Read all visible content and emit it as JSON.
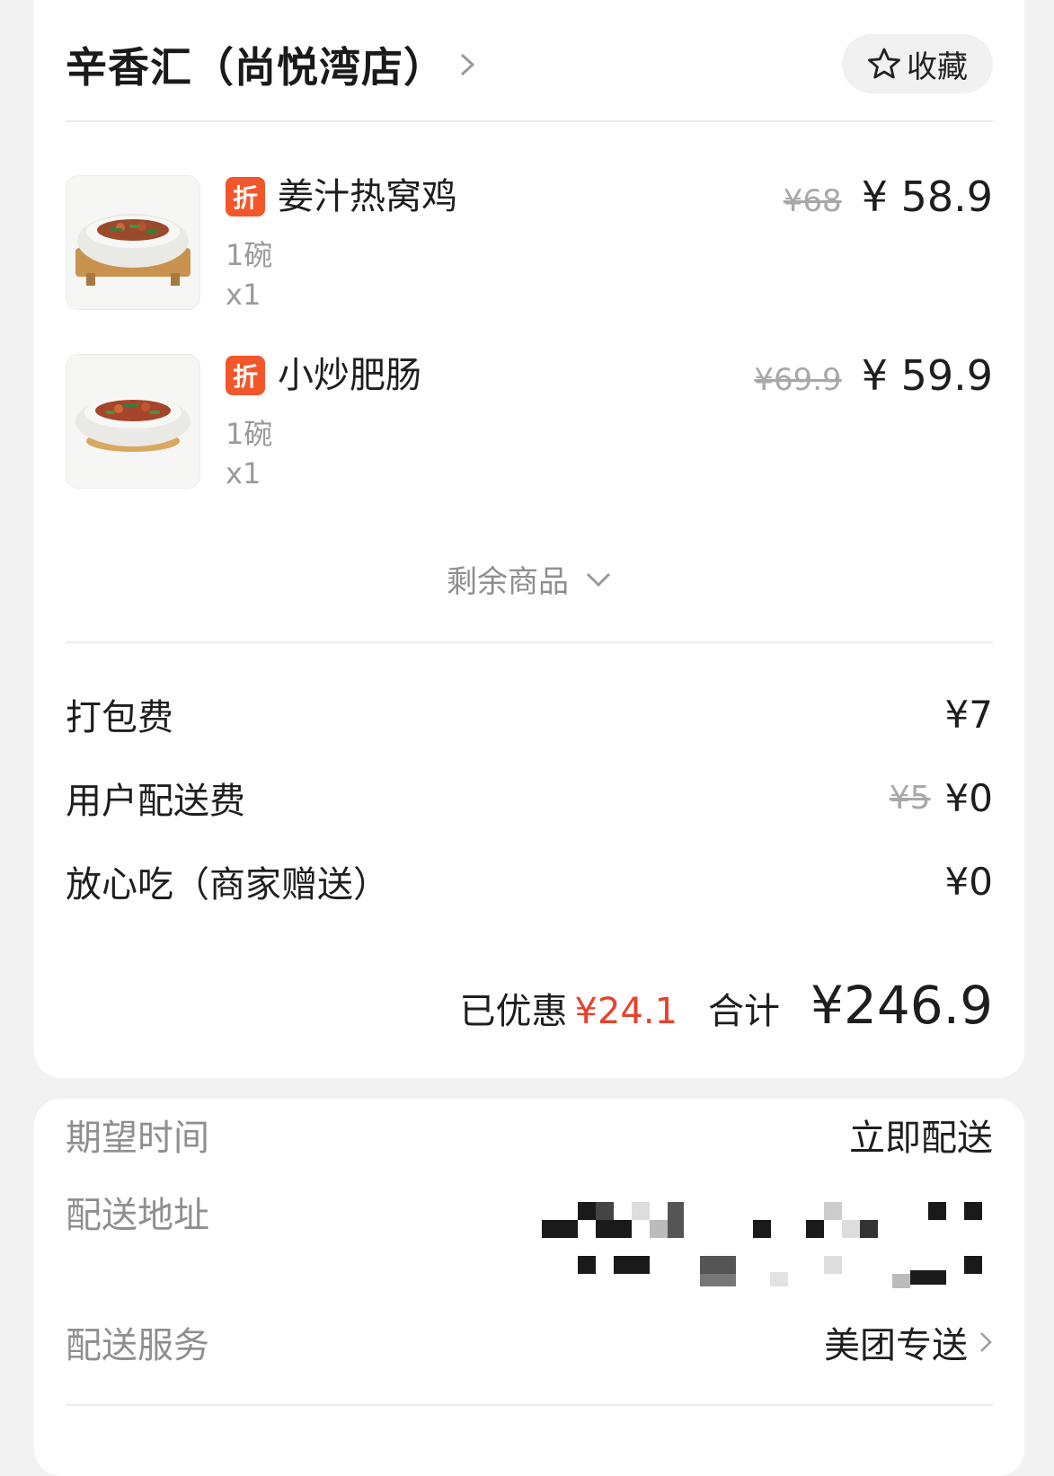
{
  "store": {
    "name": "辛香汇（尚悦湾店）",
    "favorite_label": "收藏"
  },
  "items": [
    {
      "badge": "折",
      "name": "姜汁热窝鸡",
      "spec": "1碗",
      "qty": "x1",
      "original_price": "¥68",
      "price": "¥ 58.9",
      "image": "ginger-chicken-dish"
    },
    {
      "badge": "折",
      "name": "小炒肥肠",
      "spec": "1碗",
      "qty": "x1",
      "original_price": "¥69.9",
      "price": "¥ 59.9",
      "image": "stir-fried-intestine-dish"
    }
  ],
  "more_items_label": "剩余商品",
  "fees": [
    {
      "label": "打包费",
      "original": "",
      "value": "¥7"
    },
    {
      "label": "用户配送费",
      "original": "¥5",
      "value": "¥0"
    },
    {
      "label": "放心吃（商家赠送）",
      "original": "",
      "value": "¥0"
    }
  ],
  "summary": {
    "saved_label": "已优惠",
    "saved_value": "¥24.1",
    "total_label": "合计",
    "total_value": "¥246.9"
  },
  "delivery": {
    "time_label": "期望时间",
    "time_value": "立即配送",
    "address_label": "配送地址",
    "service_label": "配送服务",
    "service_value": "美团专送"
  },
  "colors": {
    "badge": "#f2562b",
    "saved": "#e9412b",
    "background": "#f2f2f2"
  }
}
